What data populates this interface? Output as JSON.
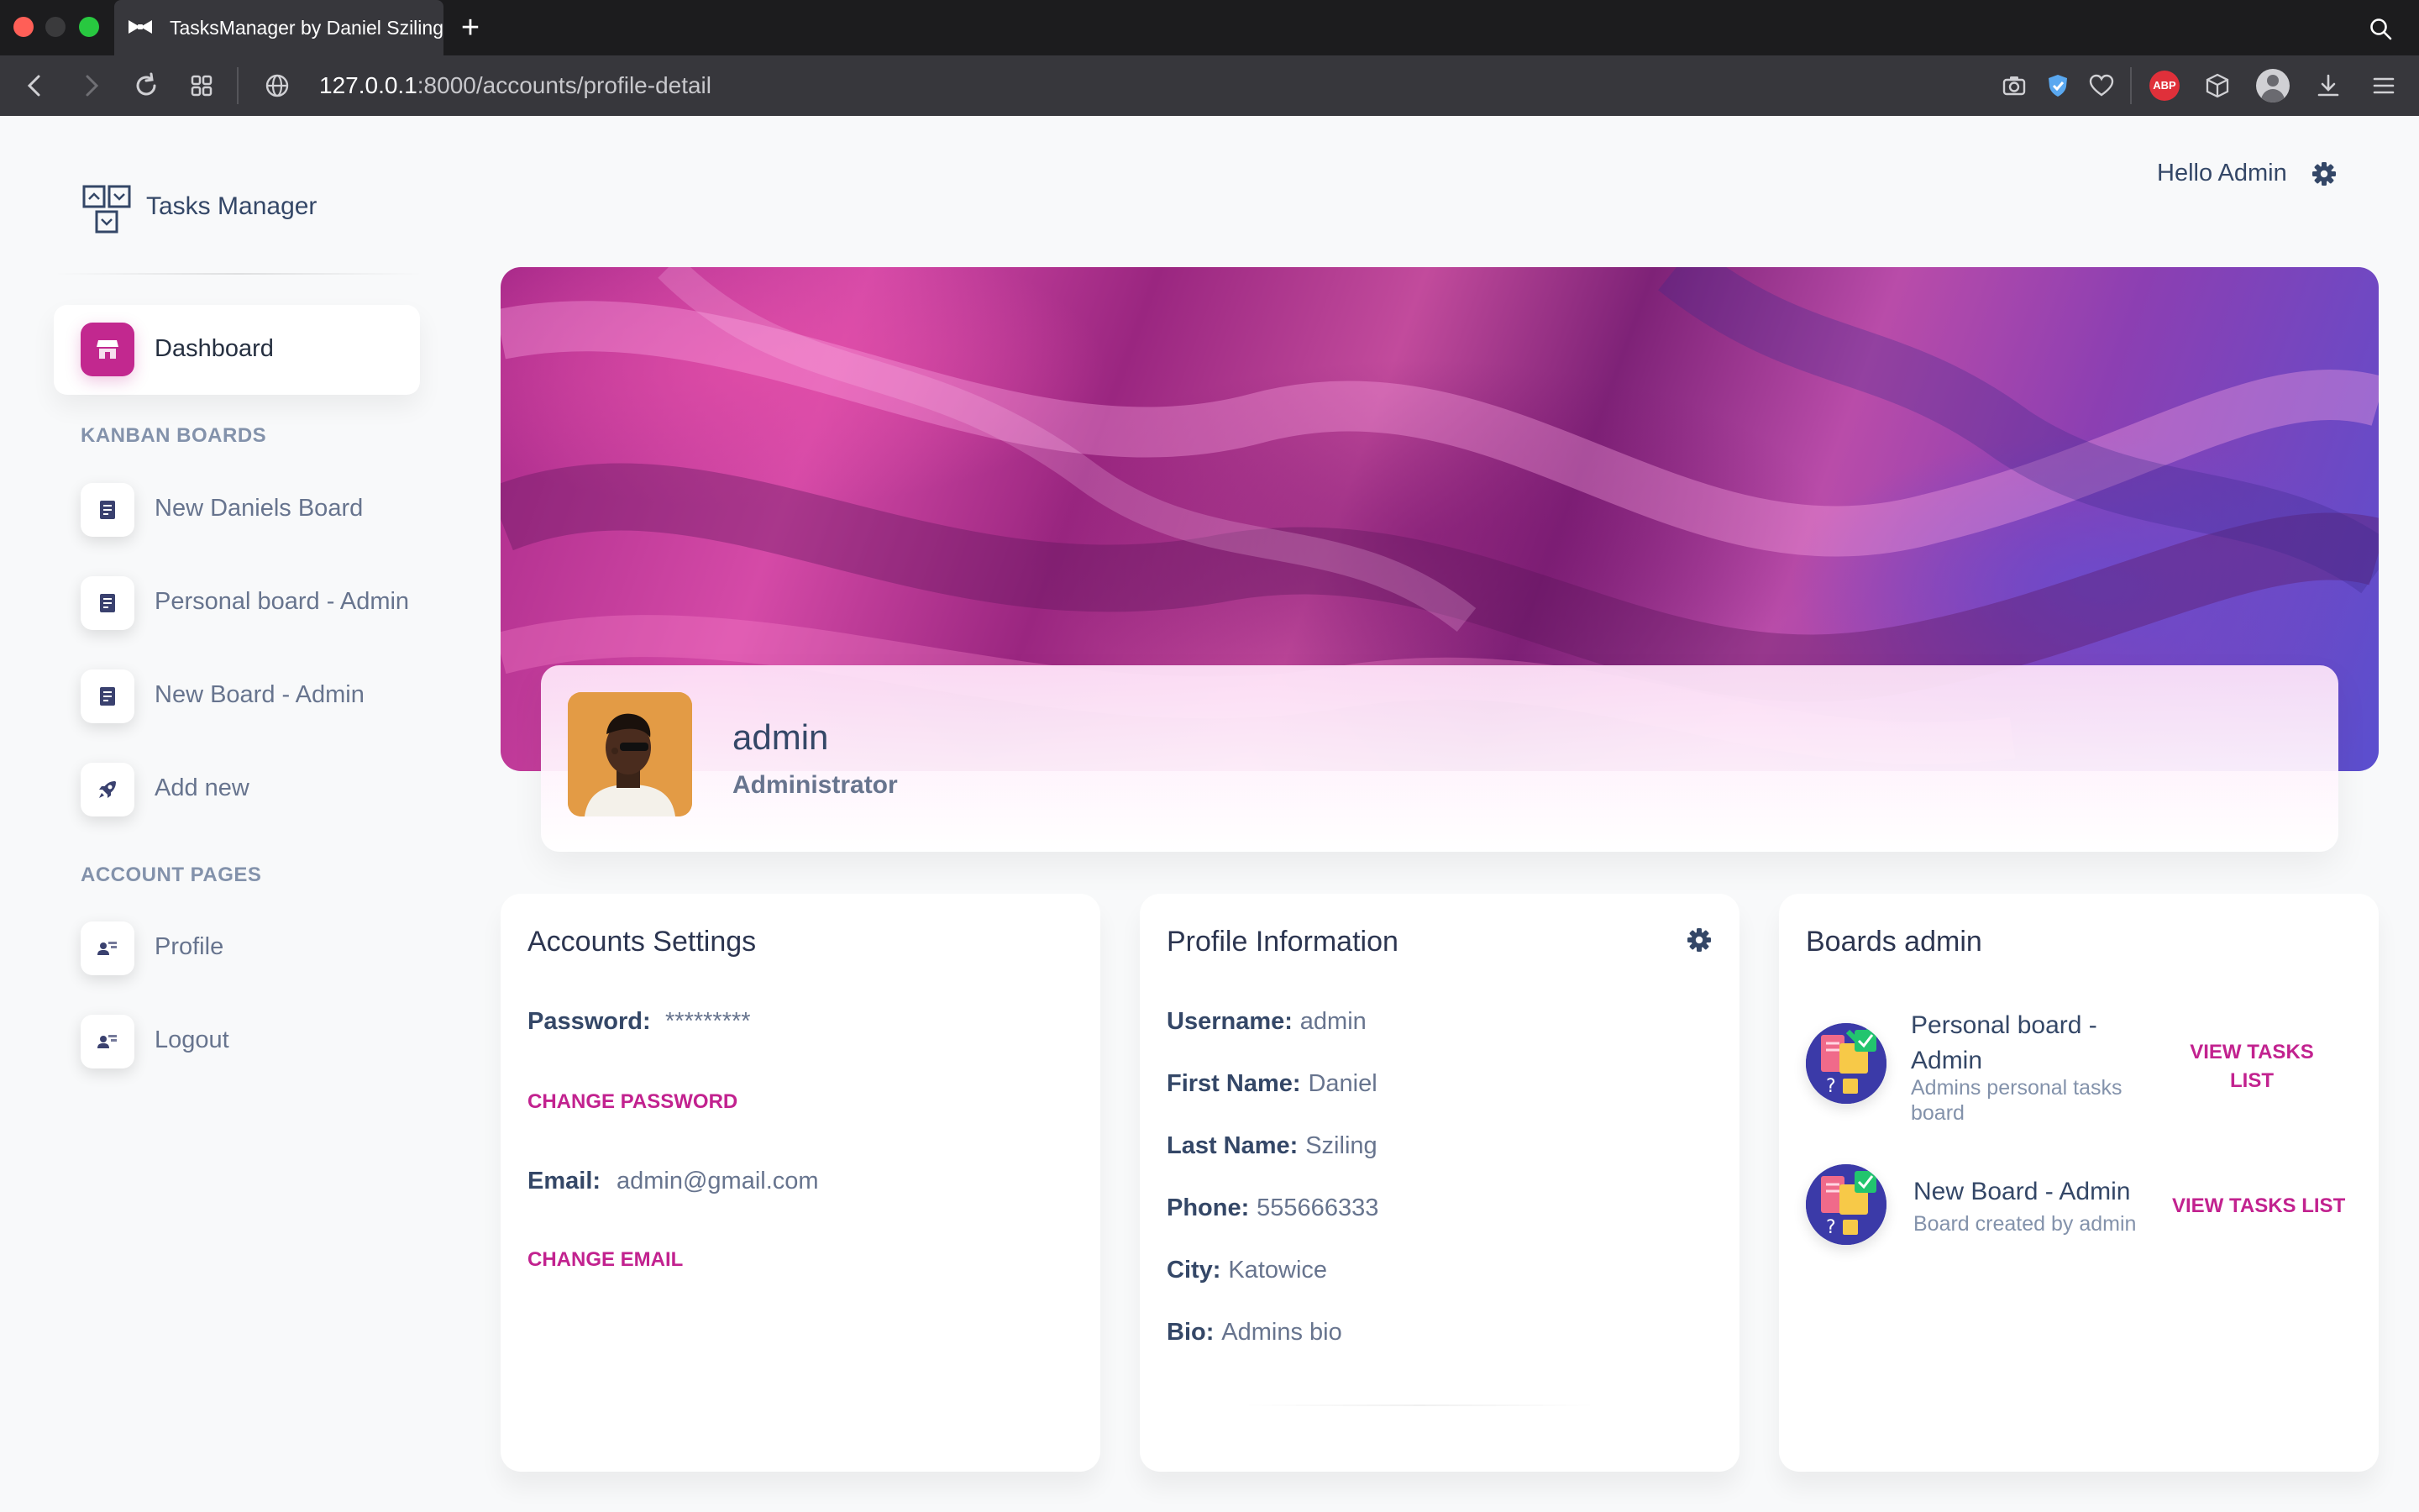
{
  "browser": {
    "tab_title": "TasksManager by Daniel Sziling",
    "url_host": "127.0.0.1",
    "url_path": ":8000/accounts/profile-detail"
  },
  "sidebar": {
    "brand": "Tasks Manager",
    "dashboard_label": "Dashboard",
    "kanban_section": "KANBAN BOARDS",
    "boards": [
      {
        "label": "New Daniels Board"
      },
      {
        "label": "Personal board - Admin"
      },
      {
        "label": "New Board - Admin"
      },
      {
        "label": "Add new"
      }
    ],
    "account_section": "ACCOUNT PAGES",
    "account": [
      {
        "label": "Profile"
      },
      {
        "label": "Logout"
      }
    ]
  },
  "header": {
    "greeting": "Hello Admin"
  },
  "profile": {
    "name": "admin",
    "role": "Administrator"
  },
  "accounts_settings": {
    "title": "Accounts Settings",
    "password_label": "Password:",
    "password_value": "*********",
    "change_password": "CHANGE PASSWORD",
    "email_label": "Email:",
    "email_value": "admin@gmail.com",
    "change_email": "CHANGE EMAIL"
  },
  "profile_info": {
    "title": "Profile Information",
    "fields": [
      {
        "label": "Username:",
        "value": "admin"
      },
      {
        "label": "First Name:",
        "value": "Daniel"
      },
      {
        "label": "Last Name:",
        "value": "Sziling"
      },
      {
        "label": "Phone:",
        "value": "555666333"
      },
      {
        "label": "City:",
        "value": "Katowice"
      },
      {
        "label": "Bio:",
        "value": "Admins bio"
      }
    ]
  },
  "boards_card": {
    "title": "Boards admin",
    "items": [
      {
        "title_line1": "Personal board -",
        "title_line2": "Admin",
        "sub_line1": "Admins personal tasks",
        "sub_line2": "board",
        "link_line1": "VIEW TASKS",
        "link_line2": "LIST"
      },
      {
        "title": "New Board - Admin",
        "sub": "Board created by admin",
        "link": "VIEW TASKS LIST"
      }
    ]
  },
  "colors": {
    "accent": "#c2228f",
    "text_dark": "#344767",
    "text_muted": "#67748e"
  }
}
